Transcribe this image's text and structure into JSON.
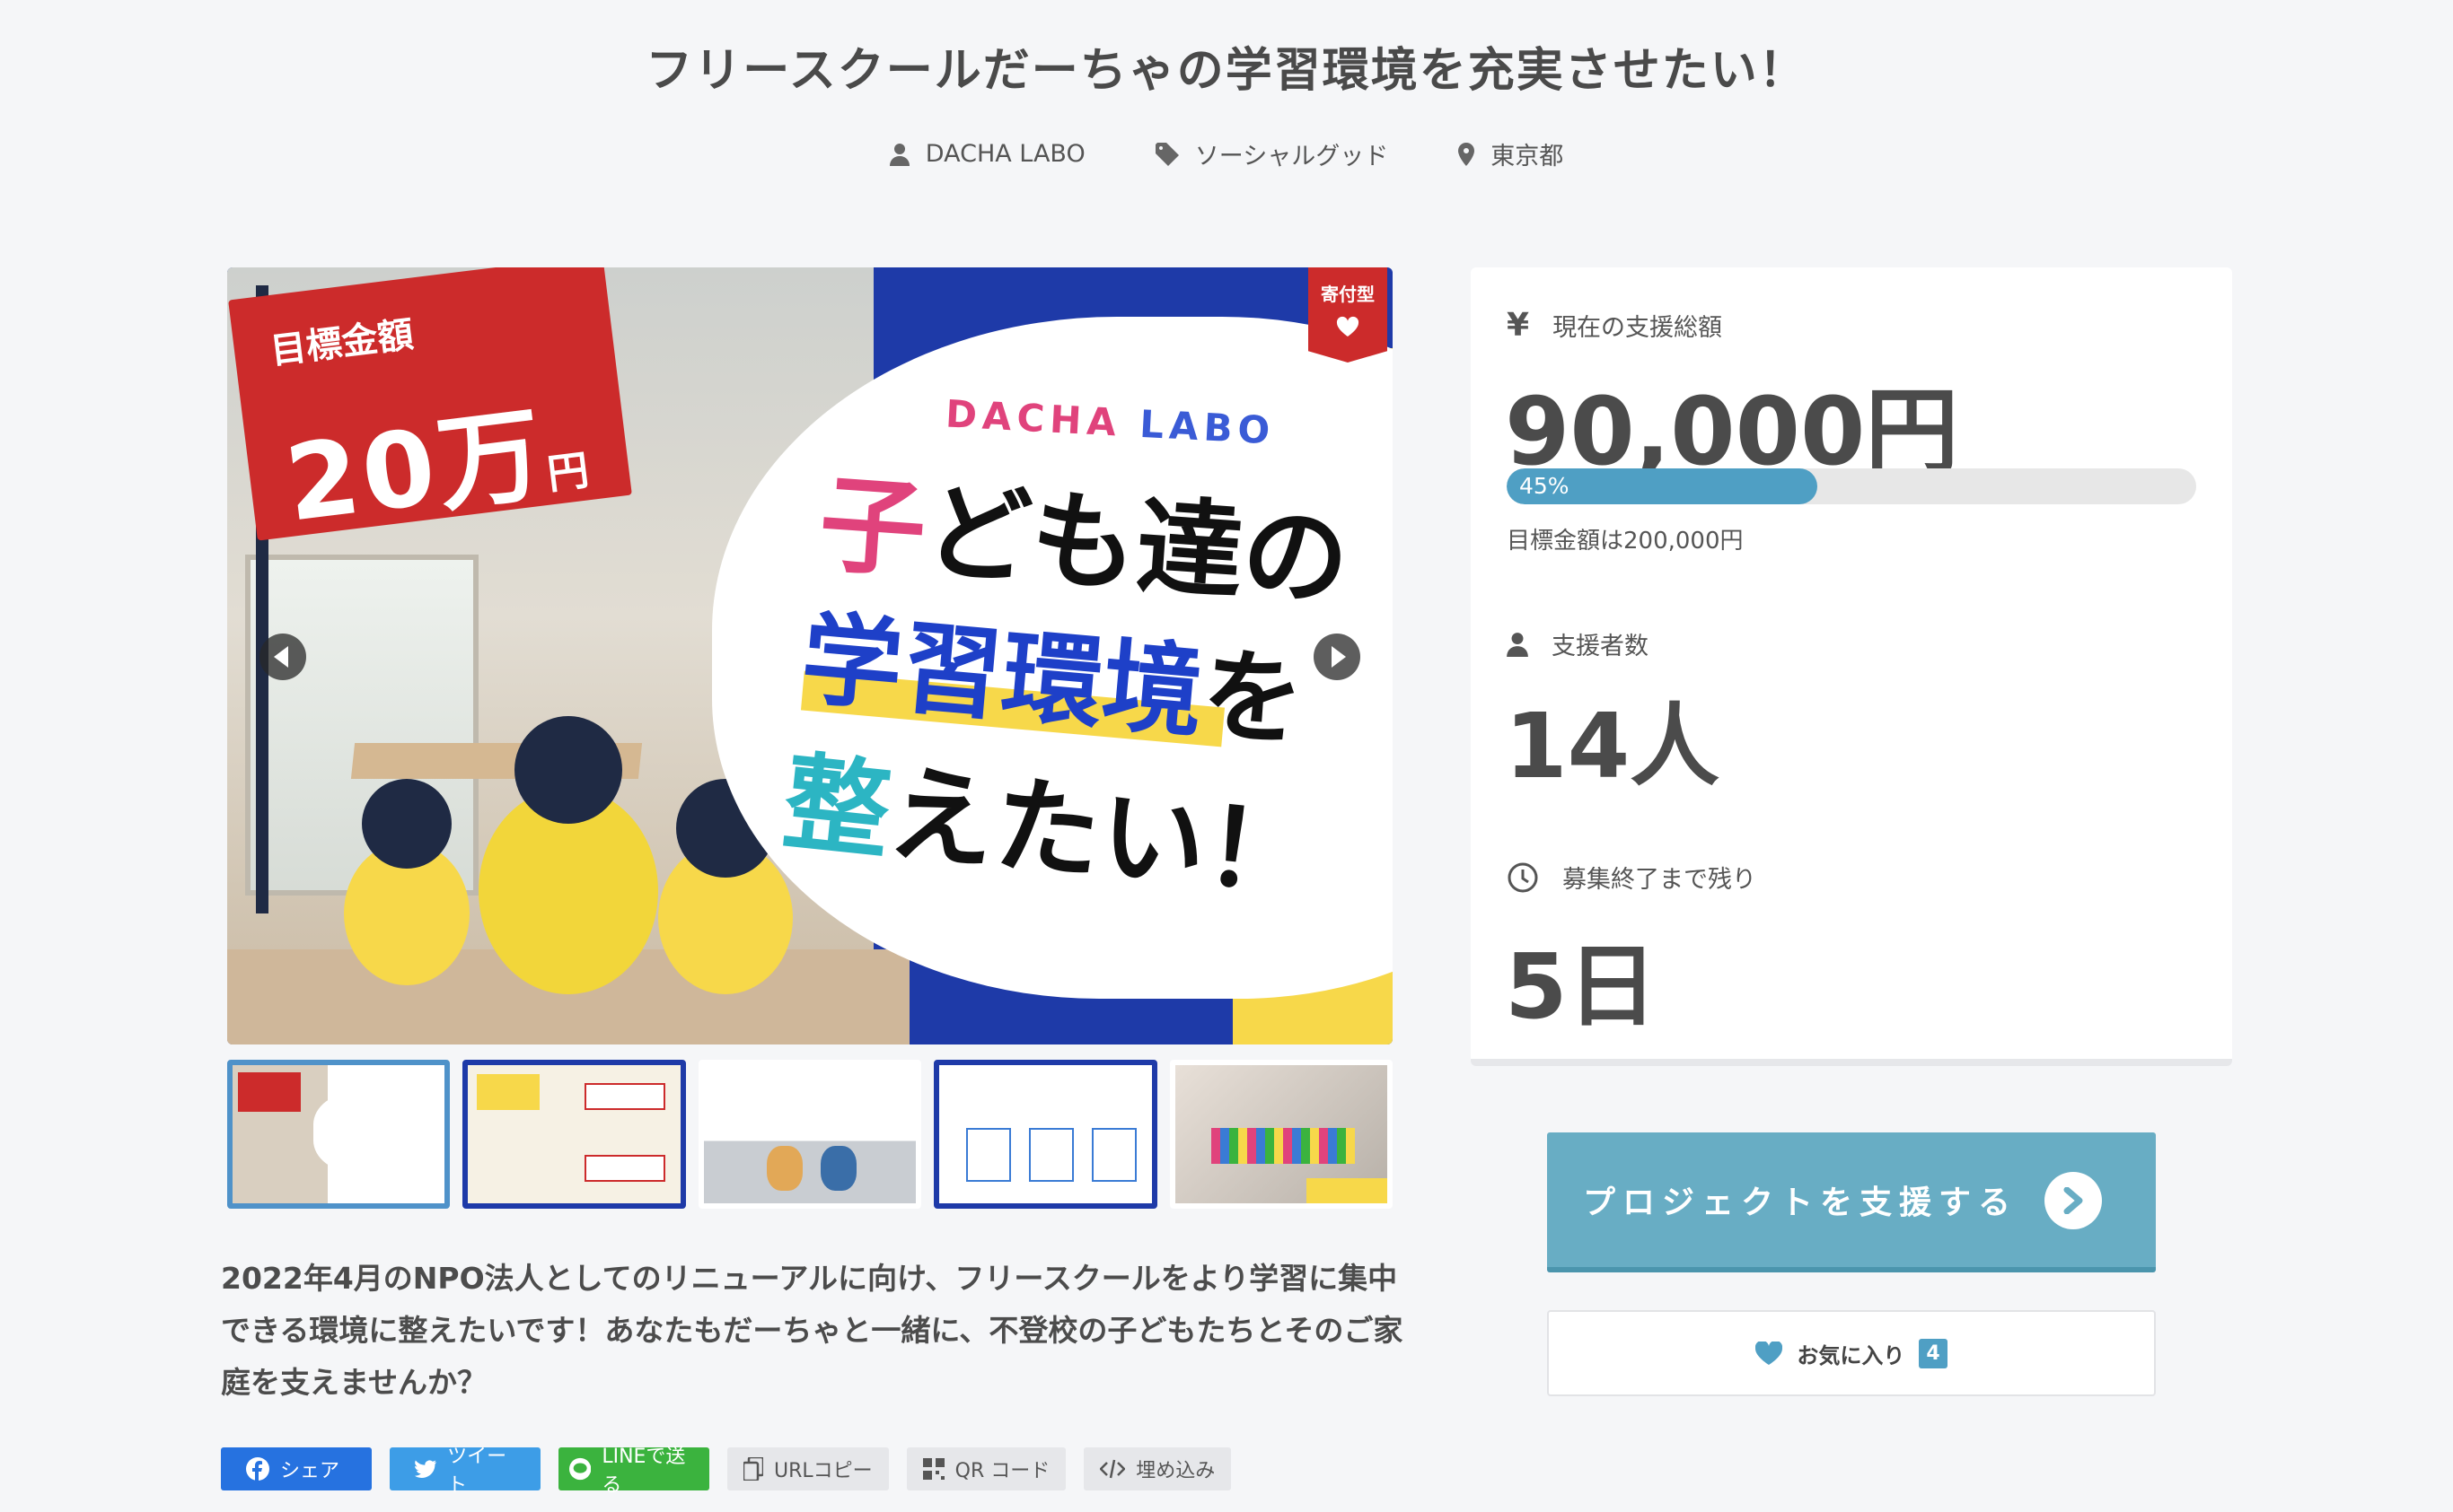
{
  "page": {
    "title": "フリースクールだーちゃの学習環境を充実させたい！",
    "meta": {
      "author": "DACHA LABO",
      "category": "ソーシャルグッド",
      "location": "東京都"
    }
  },
  "hero": {
    "flag_small": "目標金額",
    "flag_big": "20万",
    "flag_unit": "円",
    "brand_left": "DACHA",
    "brand_right": "LABO",
    "line1_pink": "子",
    "line1_rest": "ども達の",
    "line2_blue": "学習環境",
    "line2_black": "を",
    "line3_teal": "整",
    "line3_rest": "えたい！",
    "badge": "寄付型",
    "thumbnails": [
      {
        "label": "thumbnail-1"
      },
      {
        "label": "thumbnail-2"
      },
      {
        "label": "thumbnail-3"
      },
      {
        "label": "thumbnail-4"
      },
      {
        "label": "thumbnail-5"
      }
    ]
  },
  "description": "2022年4月のNPO法人としてのリニューアルに向け、フリースクールをより学習に集中できる環境に整えたいです！あなたもだーちゃと一緒に、不登校の子どもたちとそのご家庭を支えませんか？",
  "share": {
    "facebook": "シェア",
    "twitter": "ツイート",
    "line": "LINEで送る",
    "url_copy": "URLコピー",
    "qr": "QR コード",
    "embed": "埋め込み"
  },
  "stats": {
    "amount_label": "現在の支援総額",
    "amount_value": "90,000円",
    "progress_percent": 45,
    "progress_label": "45%",
    "goal_text": "目標金額は200,000円",
    "backers_label": "支援者数",
    "backers_value": "14人",
    "remaining_label": "募集終了まで残り",
    "remaining_value": "5日"
  },
  "actions": {
    "support_label": "プロジェクトを支援する",
    "favorite_label": "お気に入り",
    "favorite_count": "4"
  },
  "colors": {
    "accent": "#4f9fc4",
    "support_button": "#68adc4",
    "hero_blue": "#1e3aa8",
    "flag_red": "#cc2b2b"
  }
}
